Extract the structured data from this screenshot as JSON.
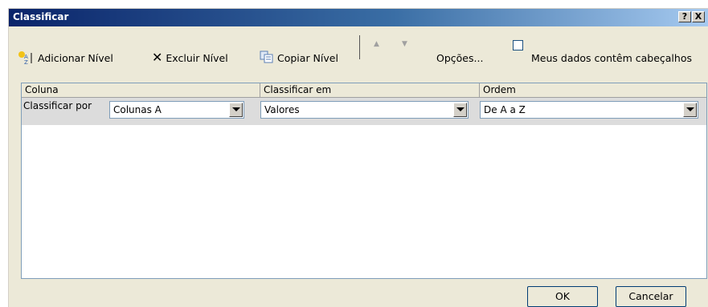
{
  "window": {
    "title": "Classificar",
    "help": "?",
    "close": "X"
  },
  "toolbar": {
    "add": "Adicionar Nível",
    "delete": "Excluir Nível",
    "copy": "Copiar Nível",
    "options": "Opções...",
    "headers_checkbox": "Meus dados contêm cabeçalhos",
    "headers_checked": false
  },
  "table": {
    "headers": {
      "column": "Coluna",
      "sort_on": "Classificar em",
      "order": "Ordem"
    },
    "row": {
      "label": "Classificar por",
      "column_value": "Colunas A",
      "sort_on_value": "Valores",
      "order_value": "De A a Z"
    }
  },
  "buttons": {
    "ok": "OK",
    "cancel": "Cancelar"
  }
}
